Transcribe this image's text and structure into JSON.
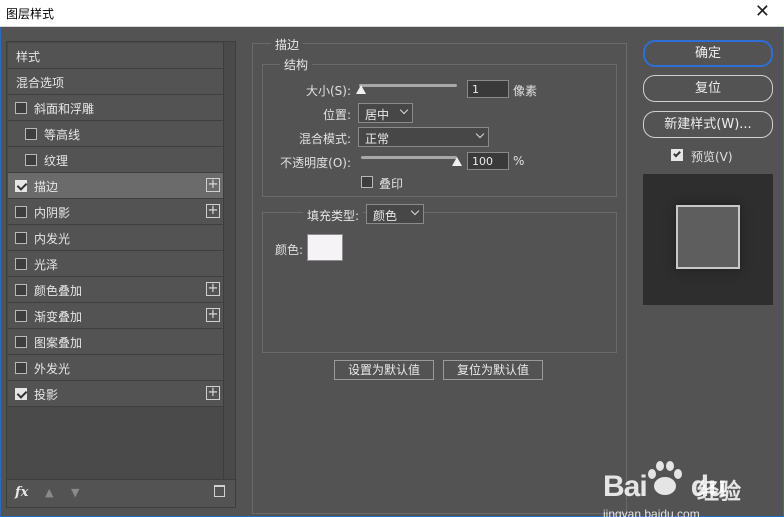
{
  "window": {
    "title": "图层样式",
    "close_glyph": "✕"
  },
  "styles": {
    "items": [
      {
        "label": "样式",
        "checkbox": false,
        "checked": false,
        "plus": false,
        "indent": false,
        "selected": false
      },
      {
        "label": "混合选项",
        "checkbox": false,
        "checked": false,
        "plus": false,
        "indent": false,
        "selected": false
      },
      {
        "label": "斜面和浮雕",
        "checkbox": true,
        "checked": false,
        "plus": false,
        "indent": false,
        "selected": false
      },
      {
        "label": "等高线",
        "checkbox": true,
        "checked": false,
        "plus": false,
        "indent": true,
        "selected": false
      },
      {
        "label": "纹理",
        "checkbox": true,
        "checked": false,
        "plus": false,
        "indent": true,
        "selected": false
      },
      {
        "label": "描边",
        "checkbox": true,
        "checked": true,
        "plus": true,
        "indent": false,
        "selected": true
      },
      {
        "label": "内阴影",
        "checkbox": true,
        "checked": false,
        "plus": true,
        "indent": false,
        "selected": false
      },
      {
        "label": "内发光",
        "checkbox": true,
        "checked": false,
        "plus": false,
        "indent": false,
        "selected": false
      },
      {
        "label": "光泽",
        "checkbox": true,
        "checked": false,
        "plus": false,
        "indent": false,
        "selected": false
      },
      {
        "label": "颜色叠加",
        "checkbox": true,
        "checked": false,
        "plus": true,
        "indent": false,
        "selected": false
      },
      {
        "label": "渐变叠加",
        "checkbox": true,
        "checked": false,
        "plus": true,
        "indent": false,
        "selected": false
      },
      {
        "label": "图案叠加",
        "checkbox": true,
        "checked": false,
        "plus": false,
        "indent": false,
        "selected": false
      },
      {
        "label": "外发光",
        "checkbox": true,
        "checked": false,
        "plus": false,
        "indent": false,
        "selected": false
      },
      {
        "label": "投影",
        "checkbox": true,
        "checked": true,
        "plus": true,
        "indent": false,
        "selected": false
      }
    ],
    "footer": {
      "fx": "fx",
      "up_glyph": "▲",
      "down_glyph": "▼"
    }
  },
  "stroke": {
    "section_title": "描边",
    "structure_title": "结构",
    "size_label": "大小(S):",
    "size_value": "1",
    "size_unit": "像素",
    "size_fraction": 0.0,
    "position_label": "位置:",
    "position_value": "居中",
    "blend_label": "混合模式:",
    "blend_value": "正常",
    "opacity_label": "不透明度(O):",
    "opacity_value": "100",
    "opacity_unit": "%",
    "opacity_fraction": 1.0,
    "overprint_label": "叠印",
    "fill_type_label": "填充类型:",
    "fill_type_value": "颜色",
    "color_label": "颜色:",
    "color_hex": "#f5f3f5",
    "set_default_label": "设置为默认值",
    "reset_default_label": "复位为默认值"
  },
  "actions": {
    "ok_label": "确定",
    "reset_label": "复位",
    "new_style_label": "新建样式(W)...",
    "preview_label": "预览(V)",
    "preview_checked": true
  },
  "watermark": {
    "logo": "Bai",
    "logo_tail": "du",
    "cn": "经验",
    "url": "jingyan.baidu.com"
  },
  "colors": {
    "accent": "#2d6fd5",
    "panel": "#535353",
    "selected": "#6b6b6b"
  }
}
